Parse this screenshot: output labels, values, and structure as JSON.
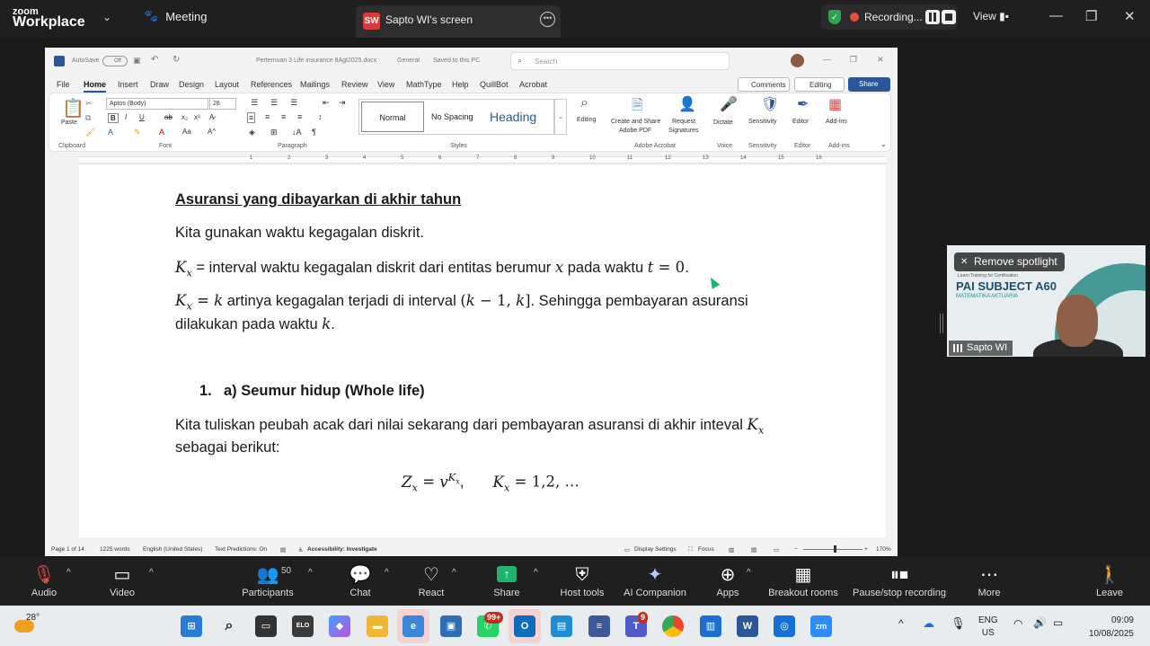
{
  "zoom": {
    "logo_top": "zoom",
    "logo_bottom": "Workplace",
    "meeting_label": "Meeting",
    "screen_badge": "SW",
    "screen_label": "Sapto WI's screen",
    "recording_label": "Recording...",
    "view_label": "View",
    "toolbar": {
      "audio": "Audio",
      "video": "Video",
      "participants": "Participants",
      "participants_count": "50",
      "chat": "Chat",
      "react": "React",
      "share": "Share",
      "host_tools": "Host tools",
      "ai_companion": "AI Companion",
      "apps": "Apps",
      "breakout_rooms": "Breakout rooms",
      "pause_stop_recording": "Pause/stop recording",
      "more": "More",
      "leave": "Leave"
    },
    "spotlight": {
      "remove_label": "Remove spotlight",
      "name": "Sapto WI",
      "slide_title": "PAI SUBJECT A60",
      "slide_subtitle": "MATEMATIKA AKTUARIA",
      "slide_small": "Learn Training for Certification"
    }
  },
  "word": {
    "titlebar": {
      "autosave": "AutoSave",
      "autosave_state": "Off",
      "filename": "Pertemuan 3 Life insurance 8Agt2025.docx",
      "label": "General",
      "saved": "Saved to this PC",
      "search_placeholder": "Search"
    },
    "menu": [
      "File",
      "Home",
      "Insert",
      "Draw",
      "Design",
      "Layout",
      "References",
      "Mailings",
      "Review",
      "View",
      "MathType",
      "Help",
      "QuillBot",
      "Acrobat"
    ],
    "comments_label": "Comments",
    "editing_label": "Editing",
    "share_label": "Share",
    "ribbon": {
      "paste": "Paste",
      "font": "Aptos (Body)",
      "size": "28",
      "style_normal": "Normal",
      "style_nospacing": "No Spacing",
      "style_heading": "Heading",
      "editing": "Editing",
      "create_share_1": "Create and Share",
      "create_share_2": "Adobe PDF",
      "request_1": "Request",
      "request_2": "Signatures",
      "dictate": "Dictate",
      "sensitivity": "Sensitivity",
      "editor": "Editor",
      "addins": "Add-ins",
      "groups": {
        "clipboard": "Clipboard",
        "font": "Font",
        "paragraph": "Paragraph",
        "styles": "Styles",
        "adobe": "Adobe Acrobat",
        "voice": "Voice",
        "sensitivity": "Sensitivity",
        "editor": "Editor",
        "addins": "Add-ins"
      }
    },
    "ruler_numbers": [
      "1",
      "2",
      "3",
      "4",
      "5",
      "6",
      "7",
      "8",
      "9",
      "10",
      "11",
      "12",
      "13",
      "14",
      "15",
      "16"
    ],
    "document": {
      "heading": "Asuransi yang dibayarkan di akhir tahun",
      "line1": "Kita gunakan waktu kegagalan diskrit.",
      "line2_text": " = interval waktu kegagalan diskrit dari entitas berumur ",
      "line2_mid": " pada waktu ",
      "line3_text": " artinya kegagalan terjadi di interval ",
      "line3_end": ". Sehingga pembayaran asuransi",
      "line4_text": "dilakukan pada waktu ",
      "list_num": "1.",
      "list_title": "a) Seumur hidup (Whole life)",
      "line5_text": "Kita tuliskan peubah acak dari nilai sekarang dari pembayaran asuransi di akhir inteval ",
      "line6": "sebagai berikut:",
      "eq_values": "1,2, …"
    },
    "status": {
      "page": "Page 1 of 14",
      "words": "1225 words",
      "language": "English (United States)",
      "predictions": "Text Predictions: On",
      "accessibility": "Accessibility: Investigate",
      "display": "Display Settings",
      "focus": "Focus",
      "zoom": "170%"
    }
  },
  "taskbar": {
    "temperature": "28°",
    "lang_top": "ENG",
    "lang_bottom": "US",
    "time": "09:09",
    "date": "10/08/2025",
    "whatsapp_badge": "99+",
    "teams_badge": "9"
  }
}
